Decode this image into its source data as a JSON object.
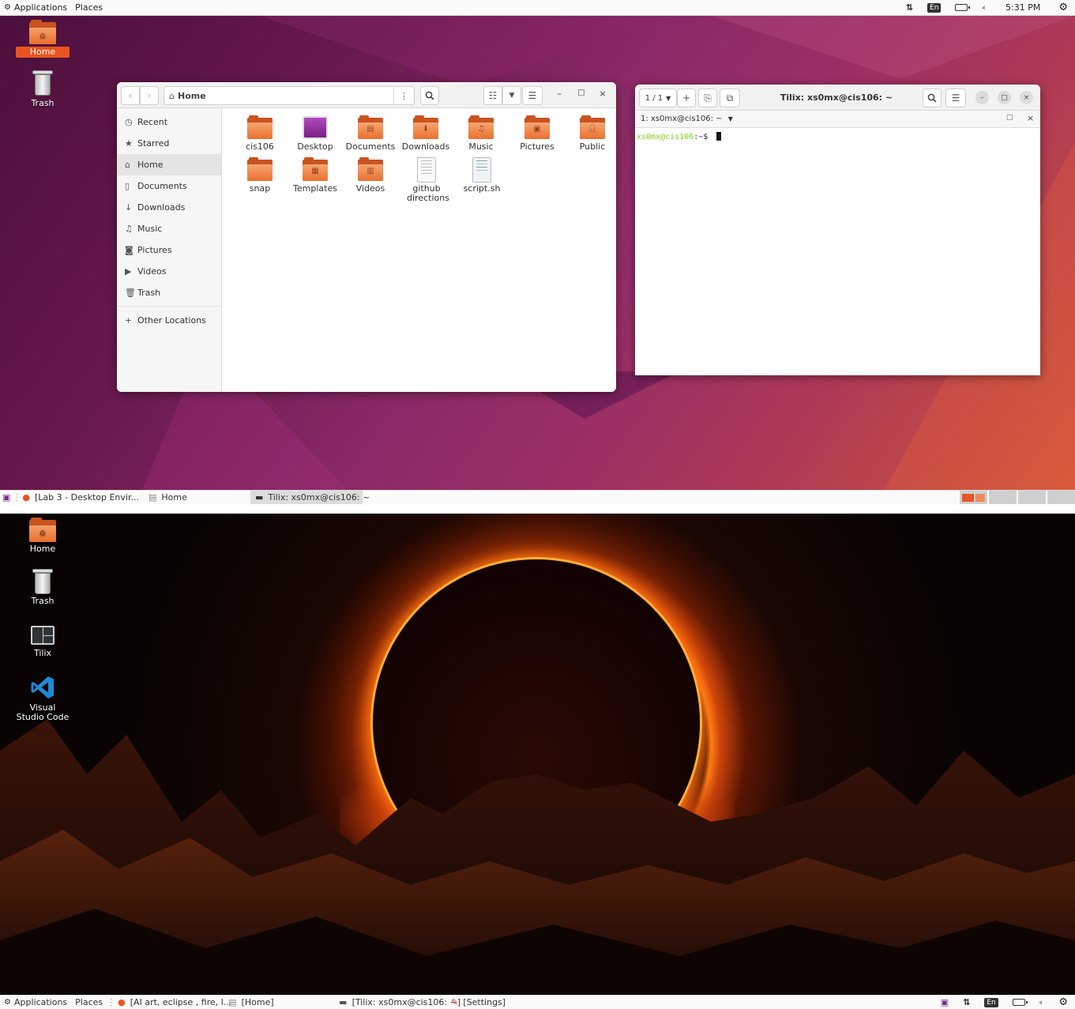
{
  "top_panel": {
    "applications": "Applications",
    "places": "Places",
    "lang": "En",
    "time": "5:31 PM"
  },
  "desktop1": {
    "icons": [
      "Home",
      "Trash"
    ]
  },
  "files": {
    "location": "Home",
    "sidebar": [
      "Recent",
      "Starred",
      "Home",
      "Documents",
      "Downloads",
      "Music",
      "Pictures",
      "Videos",
      "Trash",
      "Other Locations"
    ],
    "items": [
      "cis106",
      "Desktop",
      "Documents",
      "Downloads",
      "Music",
      "Pictures",
      "Public",
      "snap",
      "Templates",
      "Videos",
      "github directions",
      "script.sh"
    ]
  },
  "terminal": {
    "session_count": "1 / 1",
    "title": "Tilix: xs0mx@cis106: ~",
    "tab_label": "1: xs0mx@cis106: ~",
    "prompt_user": "xs0mx@cis106",
    "prompt_rest": ":~$"
  },
  "taskbar1": {
    "tasks": [
      "[Lab 3 - Desktop Envir...",
      "Home",
      "Tilix: xs0mx@cis106: ~"
    ]
  },
  "desktop2": {
    "icons": [
      "Home",
      "Trash",
      "Tilix",
      "Visual Studio Code"
    ]
  },
  "taskbar2": {
    "applications": "Applications",
    "places": "Places",
    "tasks": [
      "[AI art, eclipse , fire, l...",
      "[Home]",
      "[Tilix: xs0mx@cis106: ~]",
      "[Settings]"
    ],
    "lang": "En"
  },
  "colors": {
    "accent": "#e95420",
    "prompt": "#7fd117"
  }
}
